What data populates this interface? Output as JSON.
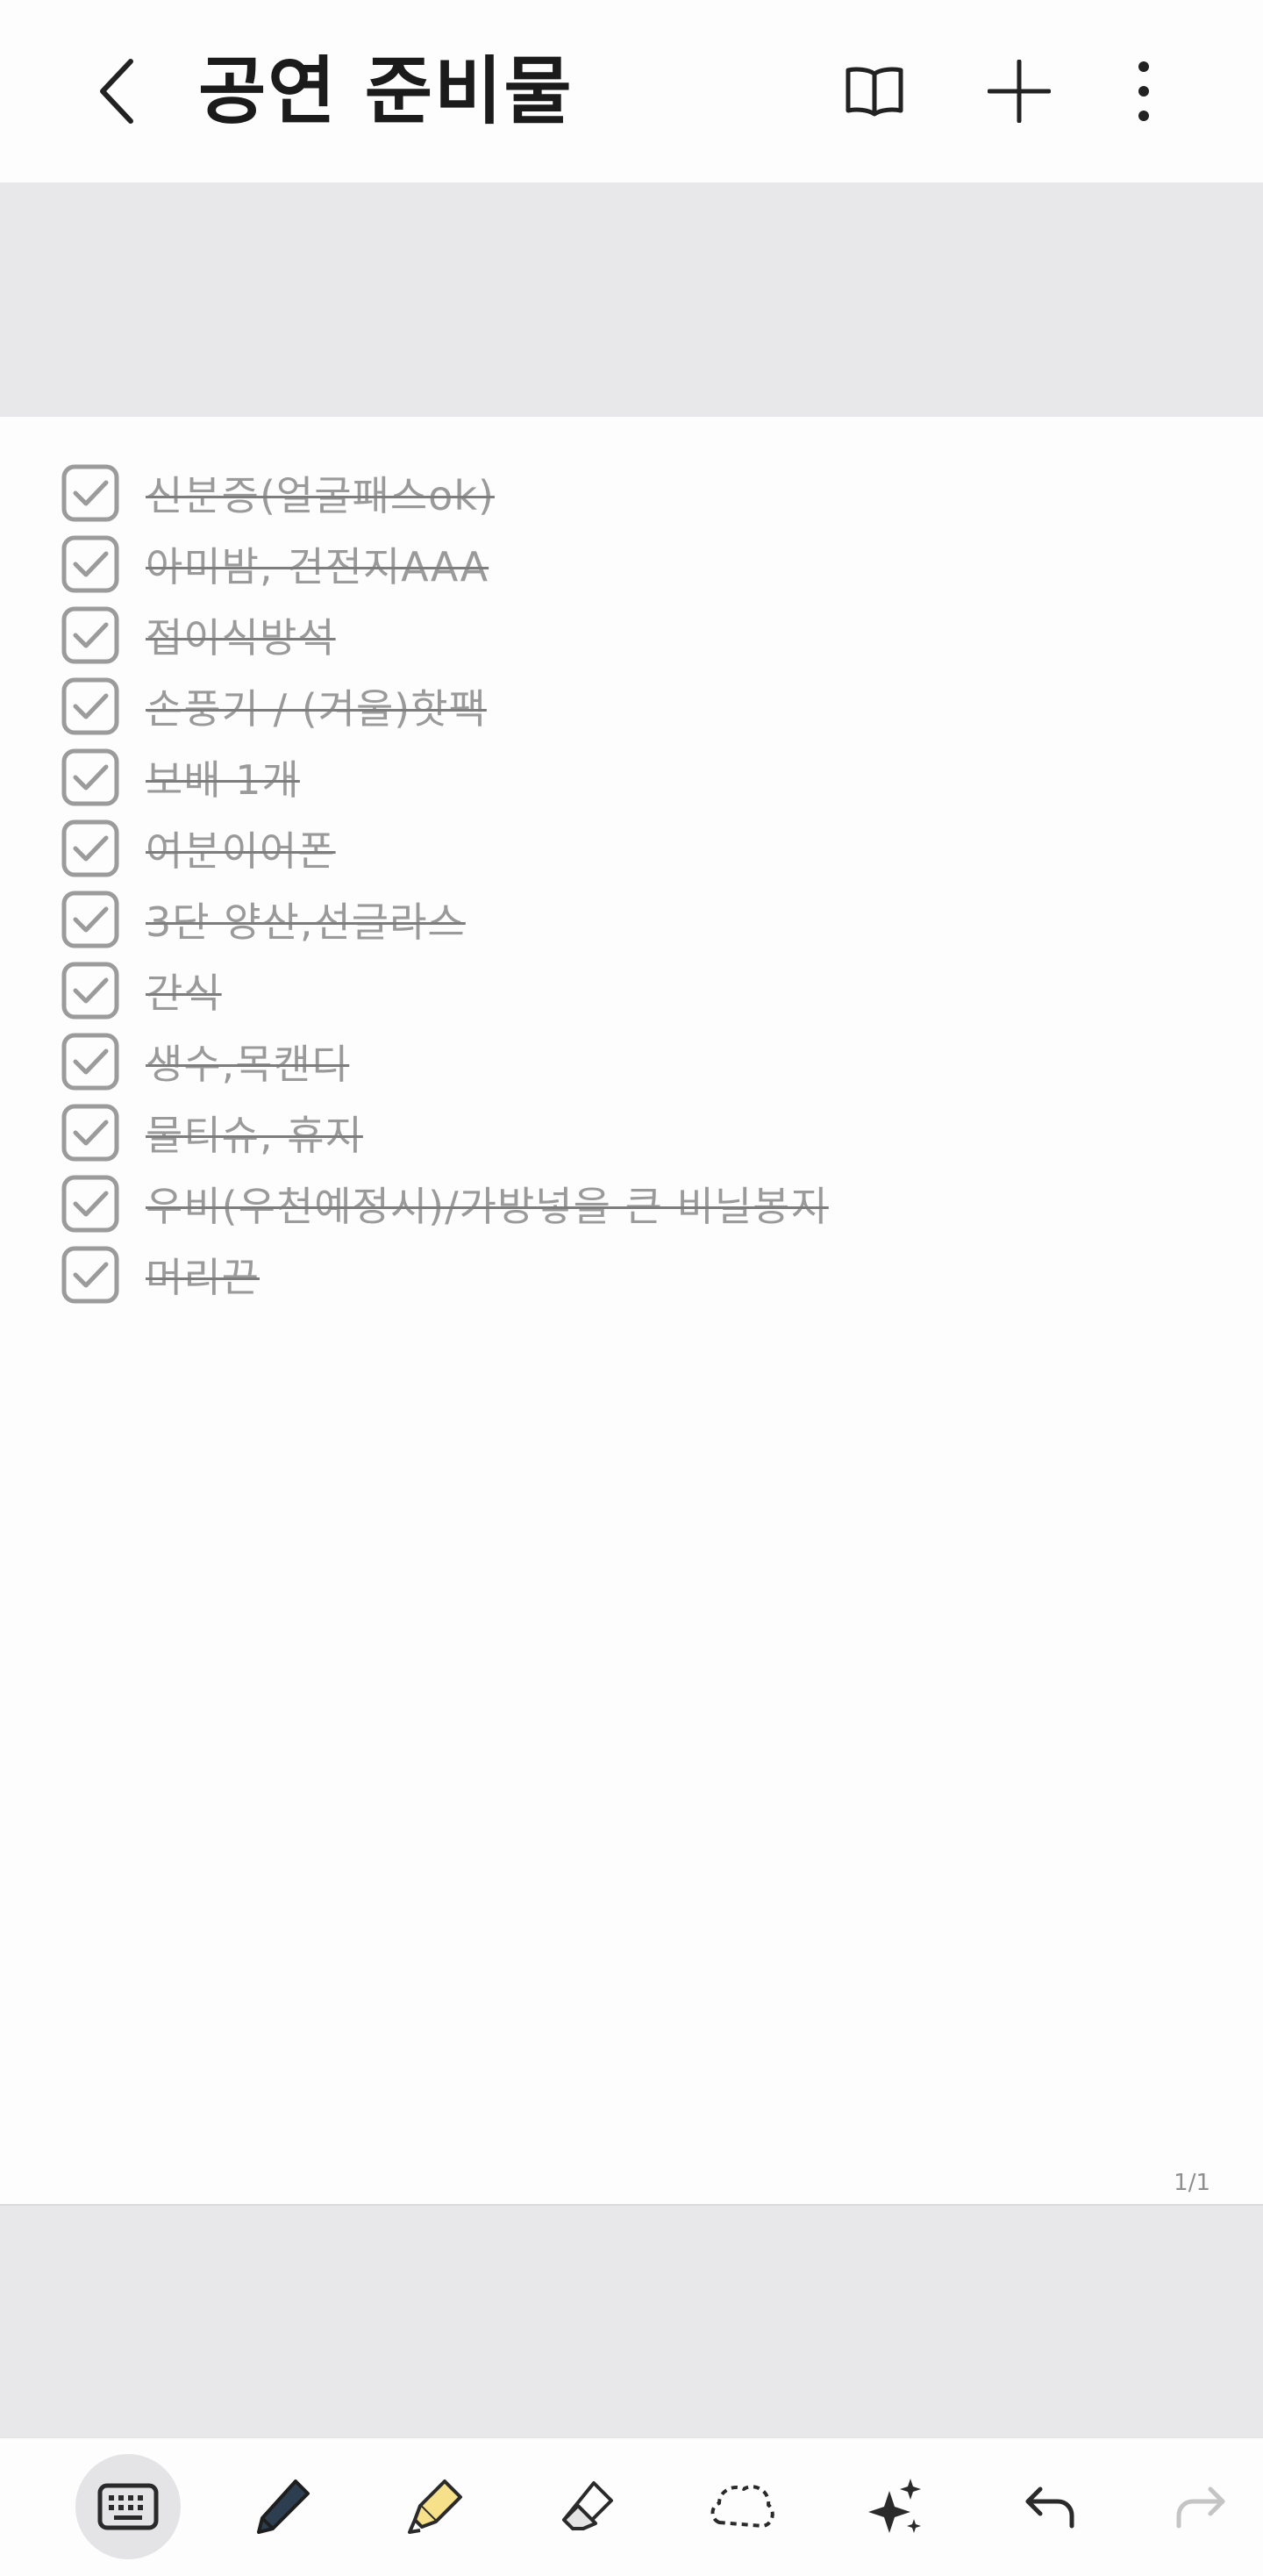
{
  "header": {
    "title": "공연 준비물",
    "icons": {
      "back": "chevron-left-icon",
      "reading_mode": "book-icon",
      "add": "plus-icon",
      "more": "more-vertical-icon"
    }
  },
  "checklist": [
    {
      "text": "신분증(얼굴패스ok)",
      "checked": true
    },
    {
      "text": "아미밤, 건전지AAA",
      "checked": true
    },
    {
      "text": "접이식방석",
      "checked": true
    },
    {
      "text": "손풍기 / (겨울)핫팩",
      "checked": true
    },
    {
      "text": "보배 1개",
      "checked": true
    },
    {
      "text": "여분이어폰",
      "checked": true
    },
    {
      "text": "3단 양산,선글라스",
      "checked": true
    },
    {
      "text": "간식",
      "checked": true
    },
    {
      "text": "생수,목캔디",
      "checked": true
    },
    {
      "text": "물티슈, 휴지",
      "checked": true
    },
    {
      "text": "우비(우천예정시)/가방넣을 큰 비닐봉지",
      "checked": true
    },
    {
      "text": "머리끈",
      "checked": true
    }
  ],
  "page_indicator": "1/1",
  "toolbar": {
    "tools": [
      "keyboard-icon",
      "pen-icon",
      "highlighter-icon",
      "eraser-icon",
      "lasso-icon",
      "ai-sparkle-icon",
      "undo-icon",
      "redo-icon"
    ],
    "active_tool": "keyboard-icon"
  },
  "colors": {
    "background": "#fdfdfd",
    "band": "#e8e8ea",
    "checked_text": "#9a9a9a",
    "checkbox": "#9b9b9b",
    "highlighter_yellow": "#f6e08a",
    "pen_navy": "#2d3e50"
  }
}
